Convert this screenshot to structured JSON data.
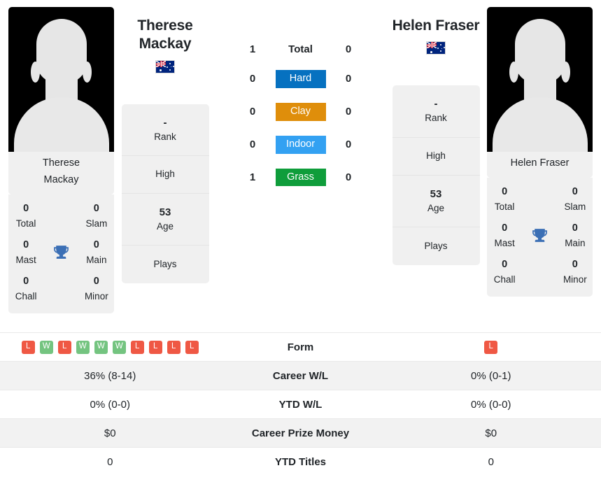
{
  "players": {
    "left": {
      "name": "Therese Mackay",
      "name_line1": "Therese",
      "name_line2": "Mackay",
      "photo_caption_line1": "Therese",
      "photo_caption_line2": "Mackay",
      "flag": "australia-flag",
      "info": {
        "rank_value": "-",
        "rank_label": "Rank",
        "high_value": "",
        "high_label": "High",
        "age_value": "53",
        "age_label": "Age",
        "plays_value": "",
        "plays_label": "Plays"
      },
      "titles": {
        "total_value": "0",
        "total_label": "Total",
        "slam_value": "0",
        "slam_label": "Slam",
        "mast_value": "0",
        "mast_label": "Mast",
        "main_value": "0",
        "main_label": "Main",
        "chall_value": "0",
        "chall_label": "Chall",
        "minor_value": "0",
        "minor_label": "Minor"
      },
      "form": [
        "L",
        "W",
        "L",
        "W",
        "W",
        "W",
        "L",
        "L",
        "L",
        "L"
      ],
      "career_wl": "36% (8-14)",
      "ytd_wl": "0% (0-0)",
      "career_prize_money": "$0",
      "ytd_titles": "0"
    },
    "right": {
      "name": "Helen Fraser",
      "name_line1": "Helen Fraser",
      "name_line2": "",
      "photo_caption_line1": "Helen Fraser",
      "photo_caption_line2": "",
      "flag": "australia-flag",
      "info": {
        "rank_value": "-",
        "rank_label": "Rank",
        "high_value": "",
        "high_label": "High",
        "age_value": "53",
        "age_label": "Age",
        "plays_value": "",
        "plays_label": "Plays"
      },
      "titles": {
        "total_value": "0",
        "total_label": "Total",
        "slam_value": "0",
        "slam_label": "Slam",
        "mast_value": "0",
        "mast_label": "Mast",
        "main_value": "0",
        "main_label": "Main",
        "chall_value": "0",
        "chall_label": "Chall",
        "minor_value": "0",
        "minor_label": "Minor"
      },
      "form": [
        "L"
      ],
      "career_wl": "0% (0-1)",
      "ytd_wl": "0% (0-0)",
      "career_prize_money": "$0",
      "ytd_titles": "0"
    }
  },
  "surfaces": [
    {
      "label": "Total",
      "left": "1",
      "right": "0",
      "style": "plain",
      "color": ""
    },
    {
      "label": "Hard",
      "left": "0",
      "right": "0",
      "style": "badge",
      "color": "#0671c0"
    },
    {
      "label": "Clay",
      "left": "0",
      "right": "0",
      "style": "badge",
      "color": "#df8e0b"
    },
    {
      "label": "Indoor",
      "left": "0",
      "right": "0",
      "style": "badge",
      "color": "#33a1f2"
    },
    {
      "label": "Grass",
      "left": "1",
      "right": "0",
      "style": "badge",
      "color": "#0f9d3b"
    }
  ],
  "table_rows": [
    {
      "label": "Form",
      "type": "form"
    },
    {
      "label": "Career W/L",
      "type": "text",
      "key": "career_wl"
    },
    {
      "label": "YTD W/L",
      "type": "text",
      "key": "ytd_wl"
    },
    {
      "label": "Career Prize Money",
      "type": "text",
      "key": "career_prize_money"
    },
    {
      "label": "YTD Titles",
      "type": "text",
      "key": "ytd_titles"
    }
  ],
  "icons": {
    "trophy": "trophy-icon"
  },
  "colors": {
    "win": "#74c480",
    "loss": "#ef5844",
    "trophy": "#3b6fb5",
    "card_bg": "#f0f0f0"
  }
}
